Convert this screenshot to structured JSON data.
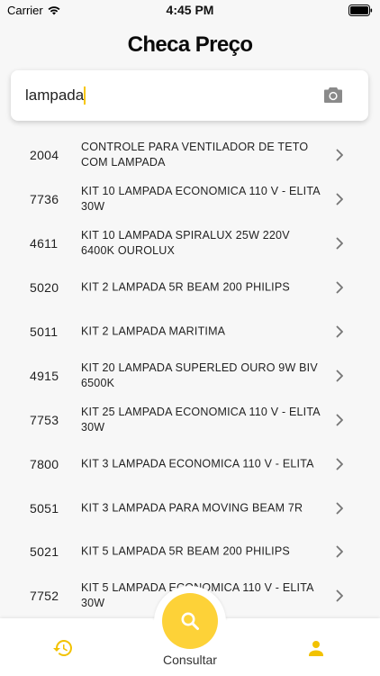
{
  "status_bar": {
    "carrier": "Carrier",
    "time": "4:45 PM"
  },
  "page_title": "Checa Preço",
  "search": {
    "value": "lampada"
  },
  "results": [
    {
      "code": "2004",
      "description": "CONTROLE PARA VENTILADOR DE TETO COM LAMPADA"
    },
    {
      "code": "7736",
      "description": "KIT 10 LAMPADA ECONOMICA 110 V - ELITA 30W"
    },
    {
      "code": "4611",
      "description": "KIT 10 LAMPADA SPIRALUX 25W 220V 6400K OUROLUX"
    },
    {
      "code": "5020",
      "description": "KIT 2 LAMPADA 5R BEAM 200 PHILIPS"
    },
    {
      "code": "5011",
      "description": "KIT 2 LAMPADA MARITIMA"
    },
    {
      "code": "4915",
      "description": "KIT 20 LAMPADA SUPERLED OURO 9W BIV 6500K"
    },
    {
      "code": "7753",
      "description": "KIT 25 LAMPADA ECONOMICA 110 V - ELITA 30W"
    },
    {
      "code": "7800",
      "description": "KIT 3 LAMPADA ECONOMICA 110 V - ELITA"
    },
    {
      "code": "5051",
      "description": "KIT 3 LAMPADA PARA MOVING BEAM 7R"
    },
    {
      "code": "5021",
      "description": "KIT 5 LAMPADA 5R BEAM 200 PHILIPS"
    },
    {
      "code": "7752",
      "description": "KIT 5 LAMPADA ECONOMICA 110 V - ELITA 30W"
    }
  ],
  "tab_bar": {
    "consult_label": "Consultar",
    "history_icon": "history-icon",
    "search_icon": "search-icon",
    "user_icon": "user-icon"
  },
  "colors": {
    "accent": "#fdd238",
    "accent_icon": "#f2c200",
    "background": "#f7f7f7"
  }
}
